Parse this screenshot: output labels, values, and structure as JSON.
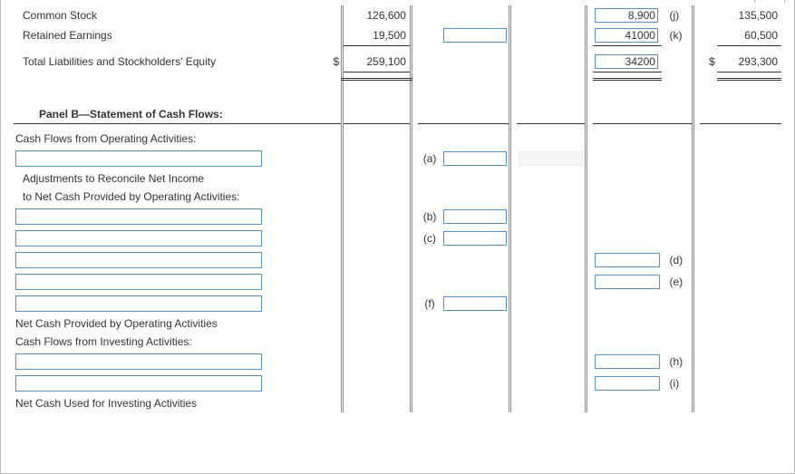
{
  "rows": {
    "common_stock": {
      "label": "Common Stock",
      "amt1": "126,600",
      "val3": "8,900",
      "tag": "(j)",
      "amt2": "135,500"
    },
    "retained": {
      "label": "Retained Earnings",
      "amt1": "19,500",
      "val3": "41000",
      "tag": "(k)",
      "amt2": "60,500"
    },
    "total": {
      "label": "Total Liabilities and Stockholders' Equity",
      "d1": "$",
      "amt1": "259,100",
      "val3": "34200",
      "d2": "$",
      "amt2": "293,300"
    }
  },
  "panelB": "Panel B—Statement of Cash Flows:",
  "cfo": "Cash Flows from Operating Activities:",
  "adj1": "Adjustments to Reconcile Net Income",
  "adj2": "to Net Cash Provided by Operating Activities:",
  "netprov": "Net Cash Provided by Operating Activities",
  "cfi": "Cash Flows from Investing Activities:",
  "netused": "Net Cash Used for Investing Activities",
  "labels": {
    "a": "(a)",
    "b": "(b)",
    "c": "(c)",
    "d": "(d)",
    "e": "(e)",
    "f": "(f)",
    "h": "(h)",
    "i": "(i)"
  }
}
